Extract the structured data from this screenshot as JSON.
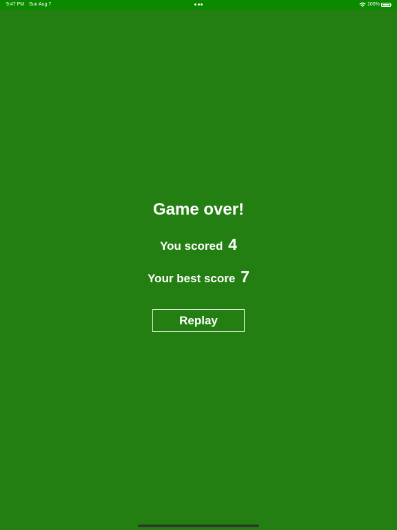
{
  "status_bar": {
    "time": "9:47 PM",
    "date": "Sun Aug 7",
    "battery_percent": "100%",
    "background_color": "#0b8a00",
    "icons": [
      "multitask-dots-icon",
      "wifi-icon",
      "battery-icon"
    ]
  },
  "game_over": {
    "title": "Game over!",
    "score_label": "You scored",
    "score_value": "4",
    "best_label": "Your best score",
    "best_value": "7",
    "replay_label": "Replay"
  },
  "colors": {
    "background": "#247f13",
    "text": "#ffffff"
  }
}
